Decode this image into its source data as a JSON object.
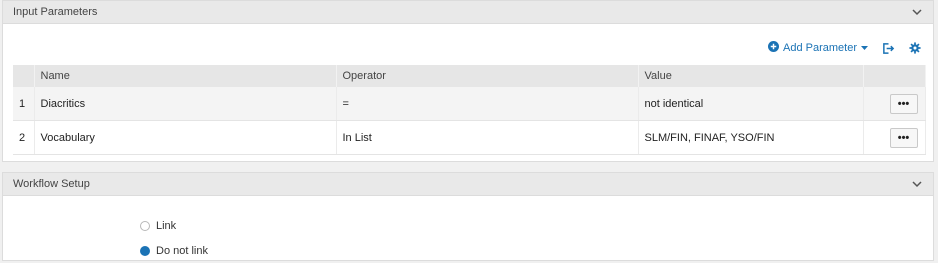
{
  "input_parameters": {
    "title": "Input Parameters",
    "toolbar": {
      "add_parameter_label": "Add Parameter",
      "icons": [
        "plus-circle-icon",
        "caret-down-icon",
        "export-icon",
        "gear-icon"
      ]
    },
    "table": {
      "columns": [
        "",
        "Name",
        "Operator",
        "Value",
        ""
      ],
      "rows": [
        {
          "index": "1",
          "name": "Diacritics",
          "operator": "=",
          "value": "not identical"
        },
        {
          "index": "2",
          "name": "Vocabulary",
          "operator": "In List",
          "value": "SLM/FIN, FINAF, YSO/FIN"
        }
      ]
    }
  },
  "workflow_setup": {
    "title": "Workflow Setup",
    "options": [
      {
        "label": "Link",
        "selected": false
      },
      {
        "label": "Do not link",
        "selected": true
      }
    ]
  },
  "colors": {
    "accent": "#1b73b5",
    "header_bg": "#e9e9e9",
    "page_bg": "#f0f0f0"
  }
}
